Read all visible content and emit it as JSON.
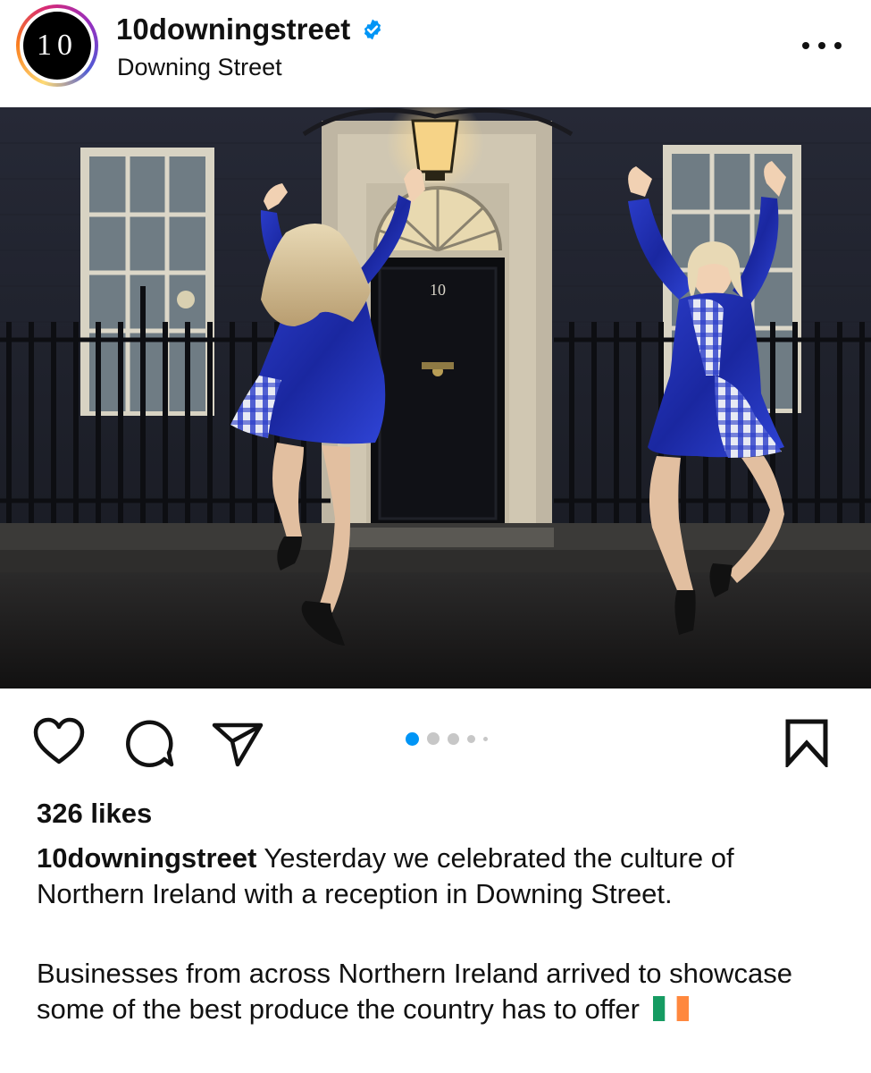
{
  "post": {
    "username": "10downingstreet",
    "location": "Downing Street",
    "avatar_text": "10",
    "door_number": "10",
    "verified": true,
    "likes": "326 likes",
    "caption_username": "10downingstreet",
    "caption_line1": " Yesterday we celebrated the culture of Northern Ireland with a reception in Downing Street.",
    "caption_paragraph2": "Businesses from across Northern Ireland arrived to showcase some of the best produce the country has to offer ",
    "carousel": {
      "count": 5,
      "active_index": 0
    }
  },
  "icons": {
    "like": "heart-icon",
    "comment": "comment-bubble-icon",
    "share": "paper-plane-icon",
    "save": "bookmark-icon",
    "more": "more-horizontal-icon",
    "verified": "verified-badge-icon",
    "flag": "ireland-flag-icon"
  },
  "colors": {
    "accent": "#0095f6",
    "verified": "#0095f6",
    "text": "#111111"
  }
}
